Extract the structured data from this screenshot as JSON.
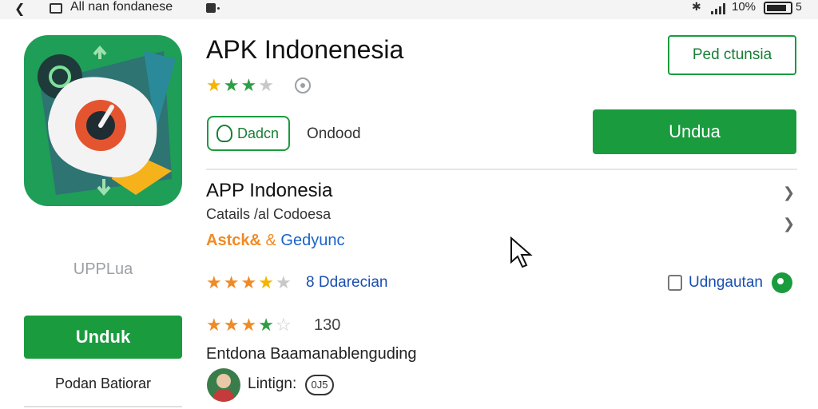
{
  "status_bar": {
    "title": "All nan fondanese",
    "battery_text": "10%",
    "battery_extra": "5",
    "icons": [
      "back-arrow-icon",
      "tabs-icon",
      "lock-icon",
      "bluetooth-icon",
      "signal-icon",
      "battery-icon"
    ]
  },
  "app": {
    "name": "APK Indonenesia",
    "rating_stars": 3,
    "left_label": "UPPLua",
    "left_install_label": "Unduk",
    "left_sub_label": "Podan Batiorar"
  },
  "header": {
    "wishlist_label": "Ped ctunsia",
    "chip_label": "Dadcn",
    "chip_after_text": "Ondood",
    "install_label": "Undua"
  },
  "details": {
    "title": "APP Indonesia",
    "subtitle": "Catails /al Codoesa",
    "tag_primary": "Astck&",
    "tag_separator": "&",
    "tag_secondary": "Gedyunc",
    "row1_rating": 3.5,
    "row1_text": "8 Ddarecian",
    "row1_link": "Udngautan",
    "row2_rating": 4,
    "row2_count": "130",
    "line_text": "Entdona Baamanablenguding",
    "listing_label": "Lintign:",
    "listing_pill": "0J5"
  },
  "colors": {
    "accent_green": "#1a9c3e",
    "star_gold": "#f4b400",
    "star_orange": "#f08a24",
    "link_blue": "#1a4fb0"
  }
}
